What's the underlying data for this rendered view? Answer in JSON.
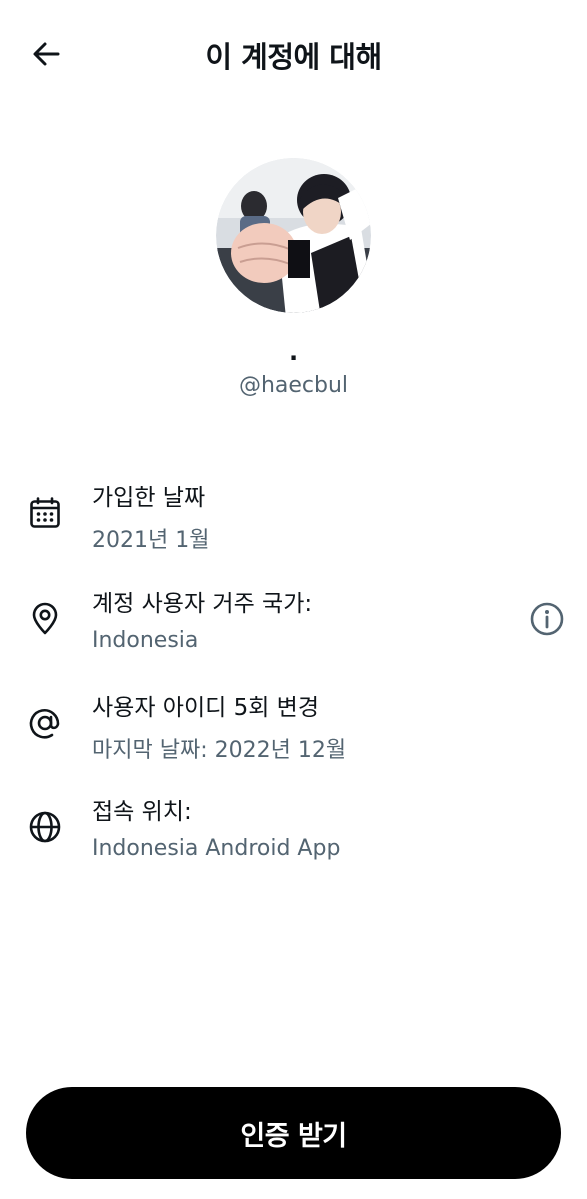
{
  "header": {
    "title": "이 계정에 대해",
    "back_icon": "arrow-left-icon"
  },
  "profile": {
    "display_name": "·",
    "handle": "@haecbul",
    "avatar_icon": "profile-photo"
  },
  "info_items": [
    {
      "icon": "calendar-icon",
      "title": "가입한 날짜",
      "value": "2021년 1월"
    },
    {
      "icon": "location-pin-icon",
      "title": "계정 사용자 거주 국가:",
      "value": "Indonesia",
      "action_icon": "info-circle-icon"
    },
    {
      "icon": "at-sign-icon",
      "title": "사용자 아이디 5회 변경",
      "value": "마지막 날짜: 2022년 12월"
    },
    {
      "icon": "globe-icon",
      "title": "접속 위치:",
      "value": "Indonesia Android App"
    }
  ],
  "footer": {
    "verify_label": "인증 받기"
  },
  "colors": {
    "text_primary": "#0f1419",
    "text_secondary": "#536471",
    "button_bg": "#000000",
    "button_text": "#ffffff"
  }
}
